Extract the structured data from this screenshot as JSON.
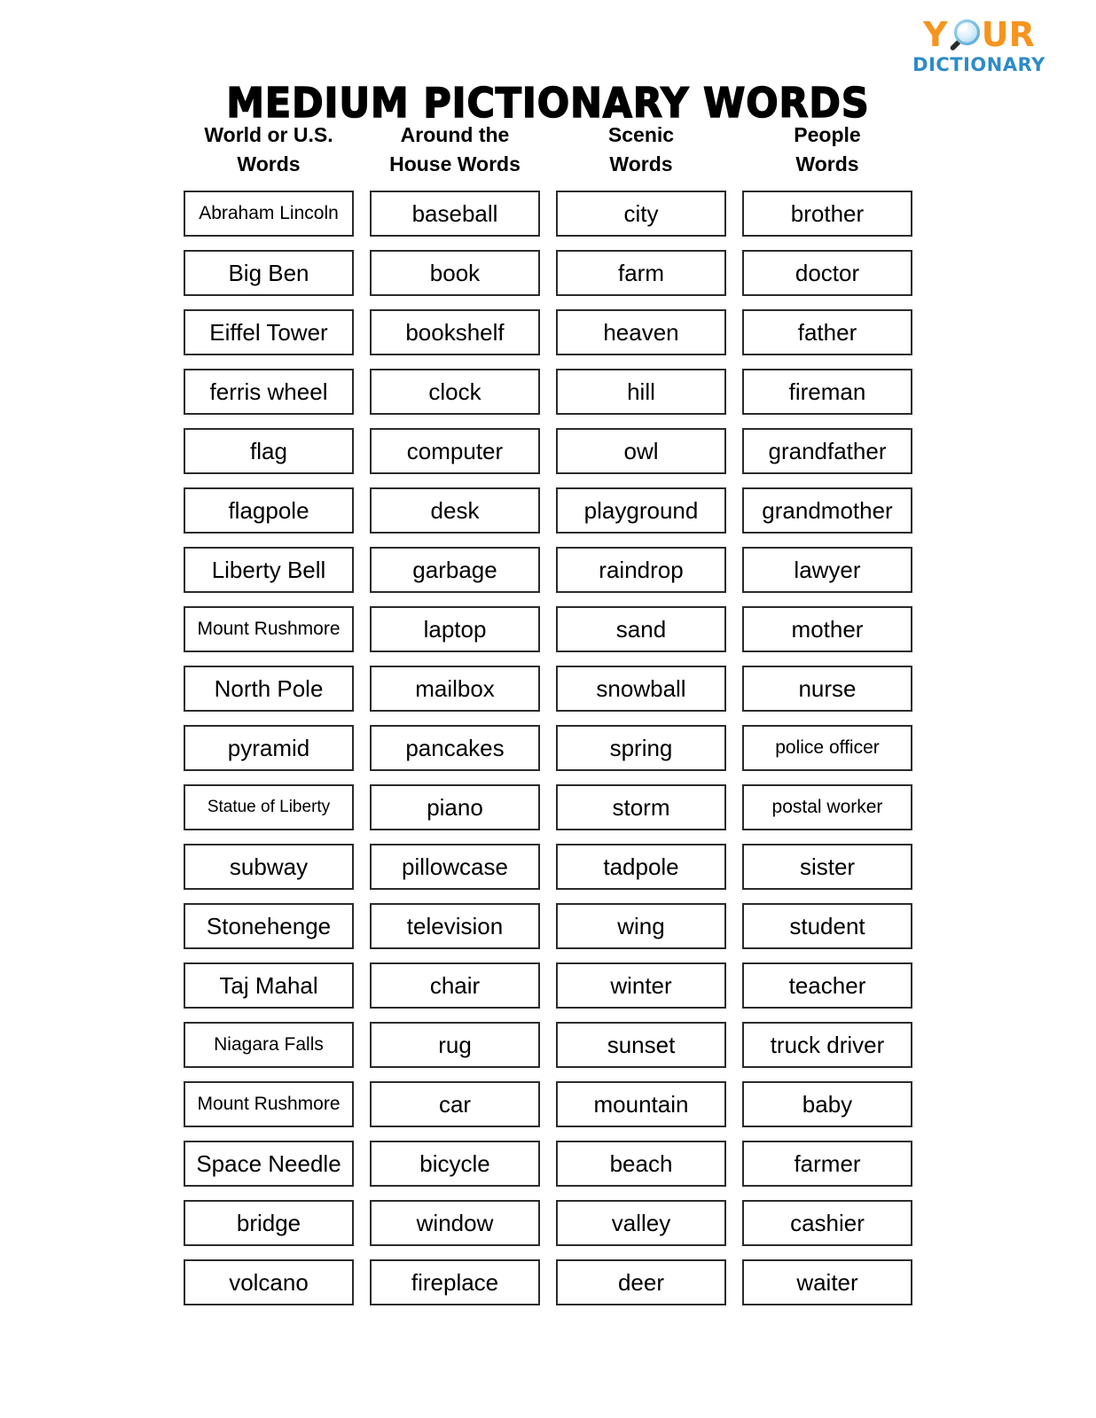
{
  "header": {
    "title": "MEDIUM PICTIONARY WORDS",
    "logo": {
      "letter_y": "Y",
      "letter_u": "U",
      "letter_r": "R",
      "wordmark_bottom": "DICTIONARY",
      "orange": "#F7941E",
      "blue": "#2E8BC8",
      "glass_icon": "magnifying-glass-icon"
    }
  },
  "columns": [
    {
      "title": "World or U.S.\nWords",
      "words": [
        "Abraham Lincoln",
        "Big Ben",
        "Eiffel Tower",
        "ferris wheel",
        "flag",
        "flagpole",
        "Liberty Bell",
        "Mount Rushmore",
        "North Pole",
        "pyramid",
        "Statue of Liberty",
        "subway",
        "Stonehenge",
        "Taj Mahal",
        "Niagara Falls",
        "Mount Rushmore",
        "Space Needle",
        "bridge",
        "volcano"
      ]
    },
    {
      "title": "Around the\nHouse Words",
      "words": [
        "baseball",
        "book",
        "bookshelf",
        "clock",
        "computer",
        "desk",
        "garbage",
        "laptop",
        "mailbox",
        "pancakes",
        "piano",
        "pillowcase",
        "television",
        "chair",
        "rug",
        "car",
        "bicycle",
        "window",
        "fireplace"
      ]
    },
    {
      "title": "Scenic\nWords",
      "words": [
        "city",
        "farm",
        "heaven",
        "hill",
        "owl",
        "playground",
        "raindrop",
        "sand",
        "snowball",
        "spring",
        "storm",
        "tadpole",
        "wing",
        "winter",
        "sunset",
        "mountain",
        "beach",
        "valley",
        "deer"
      ]
    },
    {
      "title": "People\nWords",
      "words": [
        "brother",
        "doctor",
        "father",
        "fireman",
        "grandfather",
        "grandmother",
        "lawyer",
        "mother",
        "nurse",
        "police officer",
        "postal worker",
        "sister",
        "student",
        "teacher",
        "truck driver",
        "baby",
        "farmer",
        "cashier",
        "waiter"
      ]
    }
  ]
}
